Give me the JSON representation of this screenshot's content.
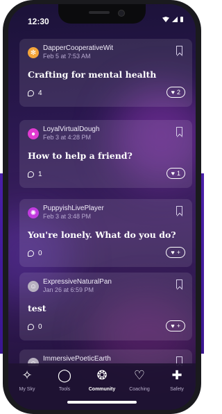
{
  "status_bar": {
    "time": "12:30"
  },
  "posts": [
    {
      "username": "DapperCooperativeWit",
      "date": "Feb 5 at 7:53 AM",
      "title": "Crafting for mental health",
      "comments": "4",
      "likes": "2",
      "avatar_color": "#f4a53a"
    },
    {
      "username": "LoyalVirtualDough",
      "date": "Feb 3 at 4:28 PM",
      "title": "How to help a friend?",
      "comments": "1",
      "likes": "1",
      "avatar_color": "#e03ad0"
    },
    {
      "username": "PuppyishLivePlayer",
      "date": "Feb 3 at 3:48 PM",
      "title": "You're lonely. What do you do?",
      "comments": "0",
      "likes": "+",
      "avatar_color": "#c23be0"
    },
    {
      "username": "ExpressiveNaturalPan",
      "date": "Jan 26 at 6:59 PM",
      "title": "test",
      "comments": "0",
      "likes": "+",
      "avatar_color": "#b7b0c0"
    },
    {
      "username": "ImmersivePoeticEarth",
      "date": "",
      "title": "",
      "comments": "",
      "likes": "",
      "avatar_color": "#b7b0c0"
    }
  ],
  "nav": {
    "items": [
      {
        "label": "My Sky",
        "icon": "sparkle-icon"
      },
      {
        "label": "Tools",
        "icon": "circle-icon"
      },
      {
        "label": "Community",
        "icon": "paw-icon"
      },
      {
        "label": "Coaching",
        "icon": "heart-icon"
      },
      {
        "label": "Safety",
        "icon": "medical-cross-icon"
      }
    ],
    "active": "Community"
  }
}
